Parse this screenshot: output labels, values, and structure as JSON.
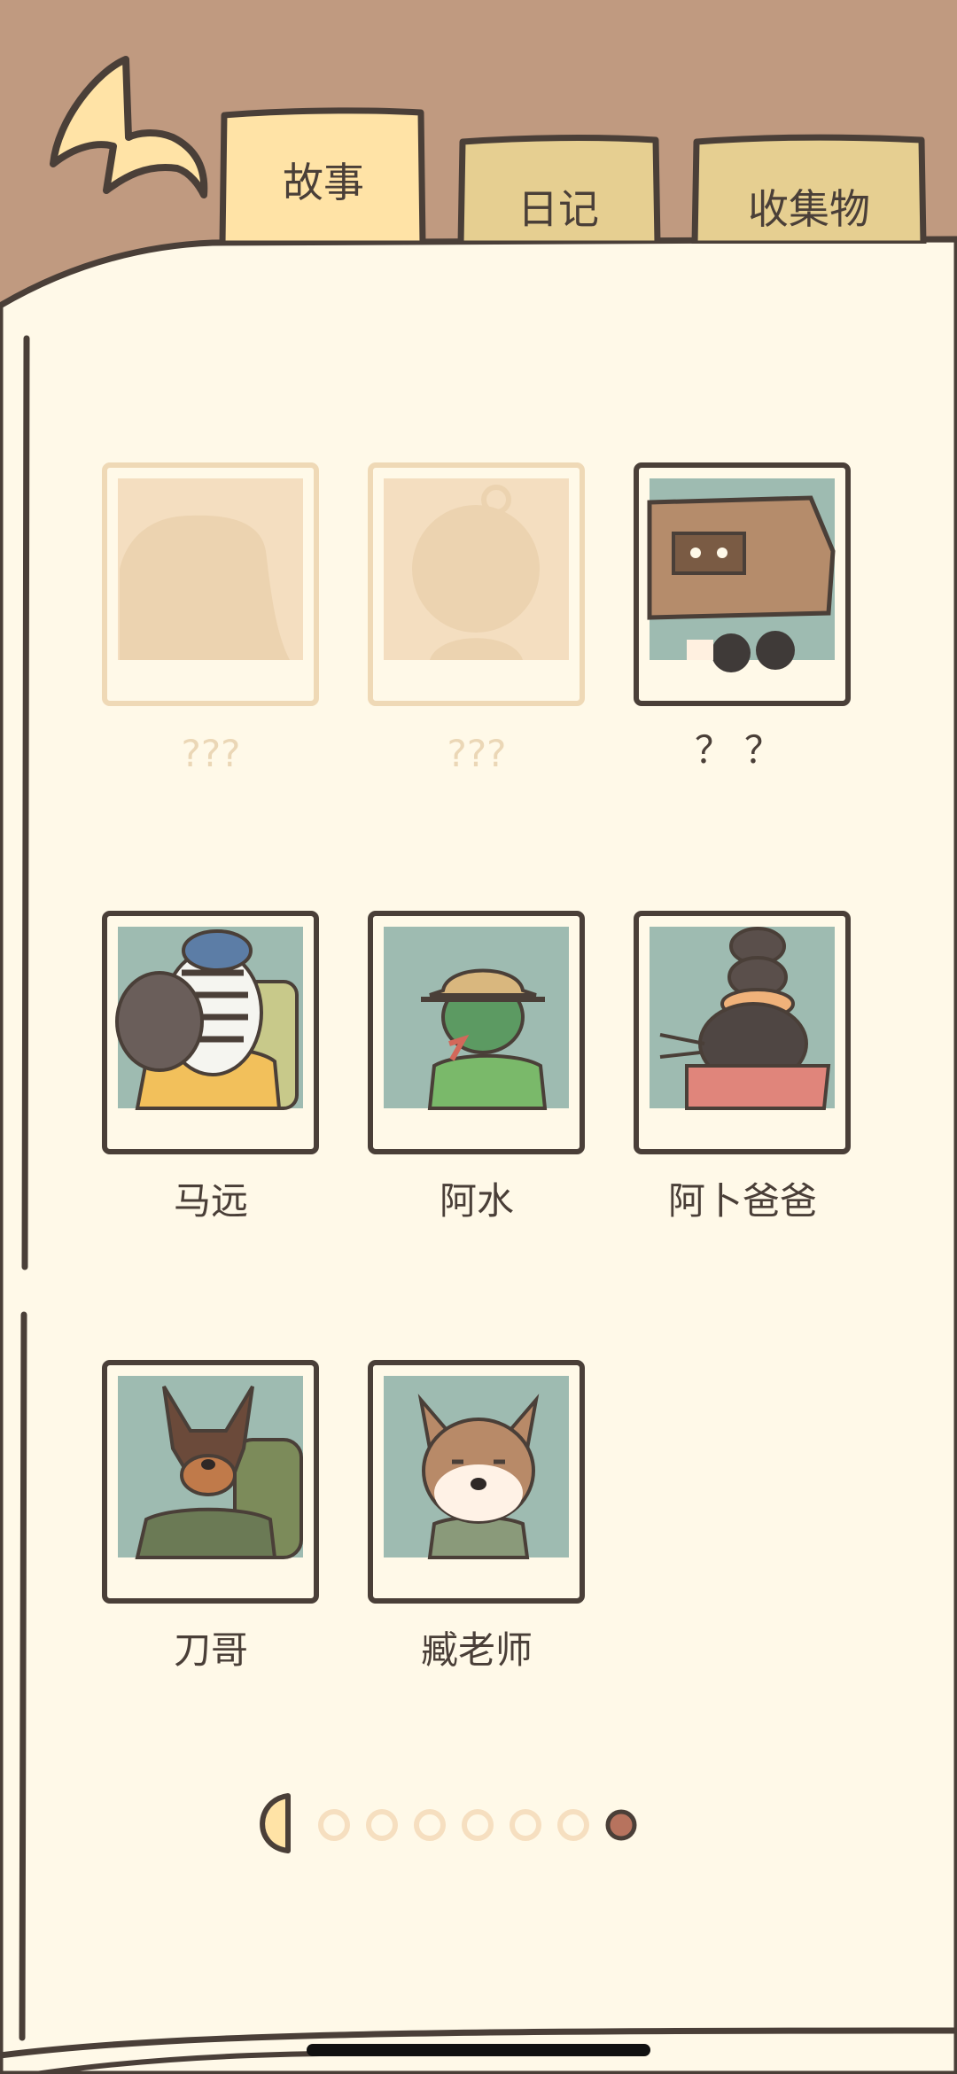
{
  "tabs": [
    {
      "label": "故事",
      "active": true
    },
    {
      "label": "日记",
      "active": false
    },
    {
      "label": "收集物",
      "active": false
    }
  ],
  "characters": [
    {
      "name": "???",
      "state": "locked"
    },
    {
      "name": "???",
      "state": "locked"
    },
    {
      "name": "？？",
      "state": "unknown"
    },
    {
      "name": "马远",
      "state": "unlocked"
    },
    {
      "name": "阿水",
      "state": "unlocked"
    },
    {
      "name": "阿卜爸爸",
      "state": "unlocked"
    },
    {
      "name": "刀哥",
      "state": "unlocked"
    },
    {
      "name": "臧老师",
      "state": "unlocked"
    }
  ],
  "pagination": {
    "total": 7,
    "current": 7
  },
  "colors": {
    "header_bg": "#C09A80",
    "page_bg": "#FFF9E8",
    "outline": "#4a3f38",
    "tab_active": "#FFE3A6",
    "tab_inactive": "#E6CF91",
    "portrait_bg": "#9EBBB1",
    "locked_frame": "#EFD9B6",
    "dot_inactive": "#F6DFC0",
    "dot_active": "#B7735E"
  },
  "icons": {
    "back": "curved-back-arrow-icon",
    "prev_page": "half-circle-prev-icon"
  }
}
